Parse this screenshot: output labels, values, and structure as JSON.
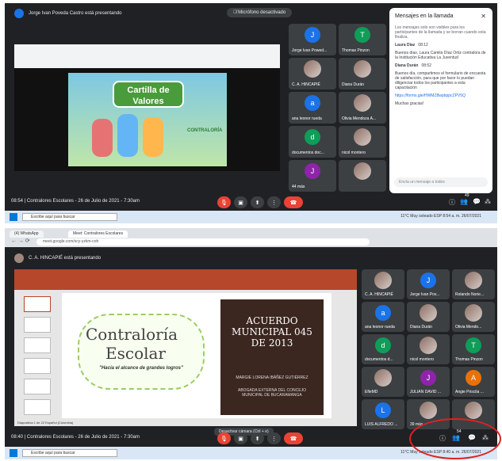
{
  "top": {
    "presenter_text": "Jorge Ivan Poveda Castro está presentando",
    "mic_banner": "Micrófono desactivado",
    "slide": {
      "title_line1": "Cartilla de",
      "title_line2": "Valores",
      "logo_text": "CONTRALORÍA"
    },
    "tiles": [
      {
        "name": "Jorge Ivan Powed...",
        "initial": "J",
        "color": "#1a73e8"
      },
      {
        "name": "Thomas Pinzon",
        "initial": "T",
        "color": "#0f9d58"
      },
      {
        "name": "C. A. HINCAPIÉ",
        "initial": "",
        "color": ""
      },
      {
        "name": "Diana Durán",
        "initial": "",
        "color": ""
      },
      {
        "name": "ana leonor rueda",
        "initial": "a",
        "color": "#1a73e8"
      },
      {
        "name": "Olivia Mendoza A...",
        "initial": "",
        "color": ""
      },
      {
        "name": "documentos doc...",
        "initial": "d",
        "color": "#0f9d58"
      },
      {
        "name": "nicol montero",
        "initial": "",
        "color": ""
      },
      {
        "name": "44 más",
        "initial": "J",
        "color": "#8e24aa"
      },
      {
        "name": "",
        "initial": "",
        "color": ""
      }
    ],
    "chat": {
      "title": "Mensajes en la llamada",
      "notice": "Los mensajes solo son visibles para los participantes de la llamada y se borran cuando esta finaliza.",
      "messages": [
        {
          "author": "Laura Díaz",
          "time": "08:12",
          "text": "Buenos días, Laura Camila Díaz Ortiz contralora de la Institución Educativa La Juventud"
        },
        {
          "author": "Diana Durán",
          "time": "08:52",
          "text": "Buenos día, compartimos el formulario de encuesta de satisfacción, para que por favor lo puedan diligenciar todos los participantes a esta capacitación"
        },
        {
          "author": "",
          "time": "",
          "text": "https://forms.gle/HWMZ8wpbppcZPV5Q"
        },
        {
          "author": "",
          "time": "",
          "text": "Muchas gracias!"
        }
      ],
      "input_placeholder": "Envía un mensaje a todos"
    },
    "meeting_info": "08:54  |  Contralores Escolares - 26 de Julio de 2021 - 7:30am",
    "participant_count": "49",
    "taskbar": {
      "search": "Escribe aquí para buscar",
      "weather": "11°C  Muy soleado",
      "lang": "ESP",
      "time": "8:54 a. m.",
      "date": "26/07/2021"
    }
  },
  "bottom": {
    "browser_tabs": [
      "(4) WhatsApp",
      "Meet: Contralores Escolares"
    ],
    "address": "meet.google.com/scy-yzkm-coh",
    "presenter_text": "C. A. HINCAPIÉ está presentando",
    "slide": {
      "title_line1": "Contraloría",
      "title_line2": "Escolar",
      "subtitle": "\"Hacia el alcance de grandes logros\"",
      "acuerdo": "ACUERDO MUNICIPAL 045 DE 2013",
      "author_name": "MARGIE LORENA IBÁÑEZ GUTIÉRREZ",
      "author_role": "ABOGADA EXTERNA DEL CONCEJO MUNICIPAL DE BUCARAMANGA"
    },
    "tiles": [
      {
        "name": "C. A. HINCAPIÉ",
        "initial": "",
        "color": ""
      },
      {
        "name": "Jorge Ivan Pov...",
        "initial": "J",
        "color": "#1a73e8"
      },
      {
        "name": "Rolando Norie...",
        "initial": "",
        "color": ""
      },
      {
        "name": "ana leonor rueda",
        "initial": "a",
        "color": "#1a73e8"
      },
      {
        "name": "Diana Durán",
        "initial": "",
        "color": ""
      },
      {
        "name": "Olivia Mendo...",
        "initial": "",
        "color": ""
      },
      {
        "name": "documentos d...",
        "initial": "d",
        "color": "#0f9d58"
      },
      {
        "name": "nicol montero",
        "initial": "",
        "color": ""
      },
      {
        "name": "Thomas Pinzon",
        "initial": "T",
        "color": "#0f9d58"
      },
      {
        "name": "EfleMD",
        "initial": "",
        "color": ""
      },
      {
        "name": "JULIAN DAVID ...",
        "initial": "J",
        "color": "#8e24aa"
      },
      {
        "name": "Angie Priscila ...",
        "initial": "A",
        "color": "#e8710a"
      },
      {
        "name": "LUIS ALFREDO ...",
        "initial": "L",
        "color": "#1a73e8"
      },
      {
        "name": "39 más",
        "initial": "",
        "color": ""
      },
      {
        "name": "",
        "initial": "",
        "color": ""
      }
    ],
    "camera_banner": "Desactivar cámara (Ctrl + e)",
    "meeting_info": "08:40  |  Contralores Escolares - 26 de Julio de 2021 - 7:30am",
    "participant_count": "54",
    "ppt_status": "Diapositiva 1 de 22    Español (Colombia)",
    "taskbar": {
      "search": "Escribe aquí para buscar",
      "weather": "11°C  Muy soleado",
      "lang": "ESP",
      "time": "8:40 a. m.",
      "date": "26/07/2021"
    }
  }
}
